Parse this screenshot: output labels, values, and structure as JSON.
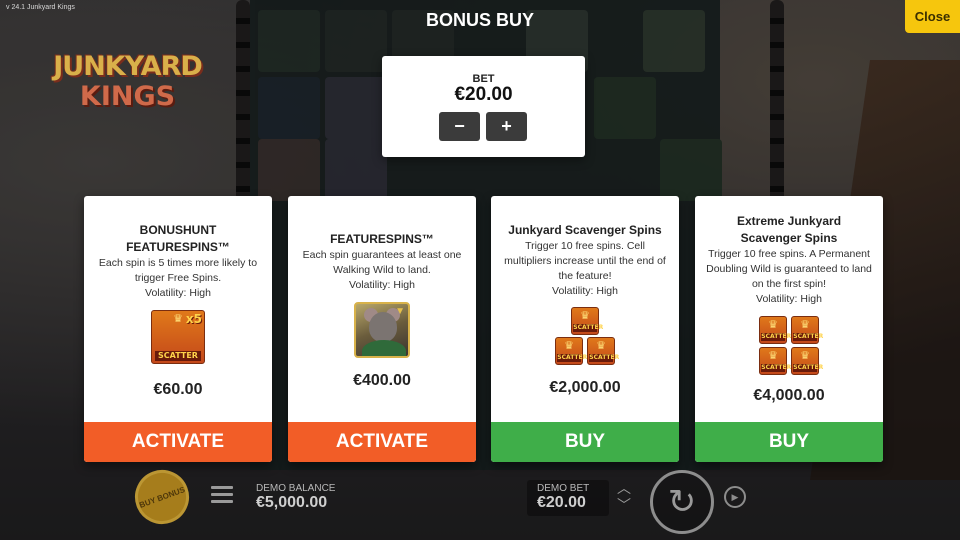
{
  "game": {
    "version_label": "v 24.1 Junkyard Kings",
    "logo_line1": "JUNKYARD",
    "logo_line2": "KINGS"
  },
  "header": {
    "title": "BONUS BUY",
    "close_label": "Close"
  },
  "bet": {
    "label": "BET",
    "value": "€20.00",
    "decrease_label": "−",
    "increase_label": "+"
  },
  "cards": [
    {
      "title": "BONUSHUNT FEATURESPINS™",
      "description": "Each spin is 5 times more likely to trigger Free Spins.",
      "volatility": "Volatility: High",
      "price": "€60.00",
      "button_label": "ACTIVATE",
      "icon": "scatter-x5-icon",
      "icon_text": "SCATTER",
      "icon_multiplier": "x5"
    },
    {
      "title": "FEATURESPINS™",
      "description": "Each spin guarantees at least one Walking Wild to land.",
      "volatility": "Volatility: High",
      "price": "€400.00",
      "button_label": "ACTIVATE",
      "icon": "walking-wild-rat-icon"
    },
    {
      "title": "Junkyard Scavenger Spins",
      "description": "Trigger 10 free spins. Cell multipliers increase until the end of the feature!",
      "volatility": "Volatility: High",
      "price": "€2,000.00",
      "button_label": "BUY",
      "icon": "three-scatters-icon",
      "icon_text": "SCATTER"
    },
    {
      "title": "Extreme Junkyard Scavenger Spins",
      "description": "Trigger 10 free spins. A Permanent Doubling Wild is guaranteed to land on the first spin!",
      "volatility": "Volatility: High",
      "price": "€4,000.00",
      "button_label": "BUY",
      "icon": "four-scatters-icon",
      "icon_text": "SCATTER"
    }
  ],
  "bottom_bar": {
    "buy_bonus_label": "BUY BONUS",
    "demo_balance_label": "DEMO BALANCE",
    "demo_balance_value": "€5,000.00",
    "demo_bet_label": "DEMO BET",
    "demo_bet_value": "€20.00"
  },
  "colors": {
    "activate": "#f25d27",
    "buy": "#3fae49",
    "close": "#f6c60d"
  }
}
